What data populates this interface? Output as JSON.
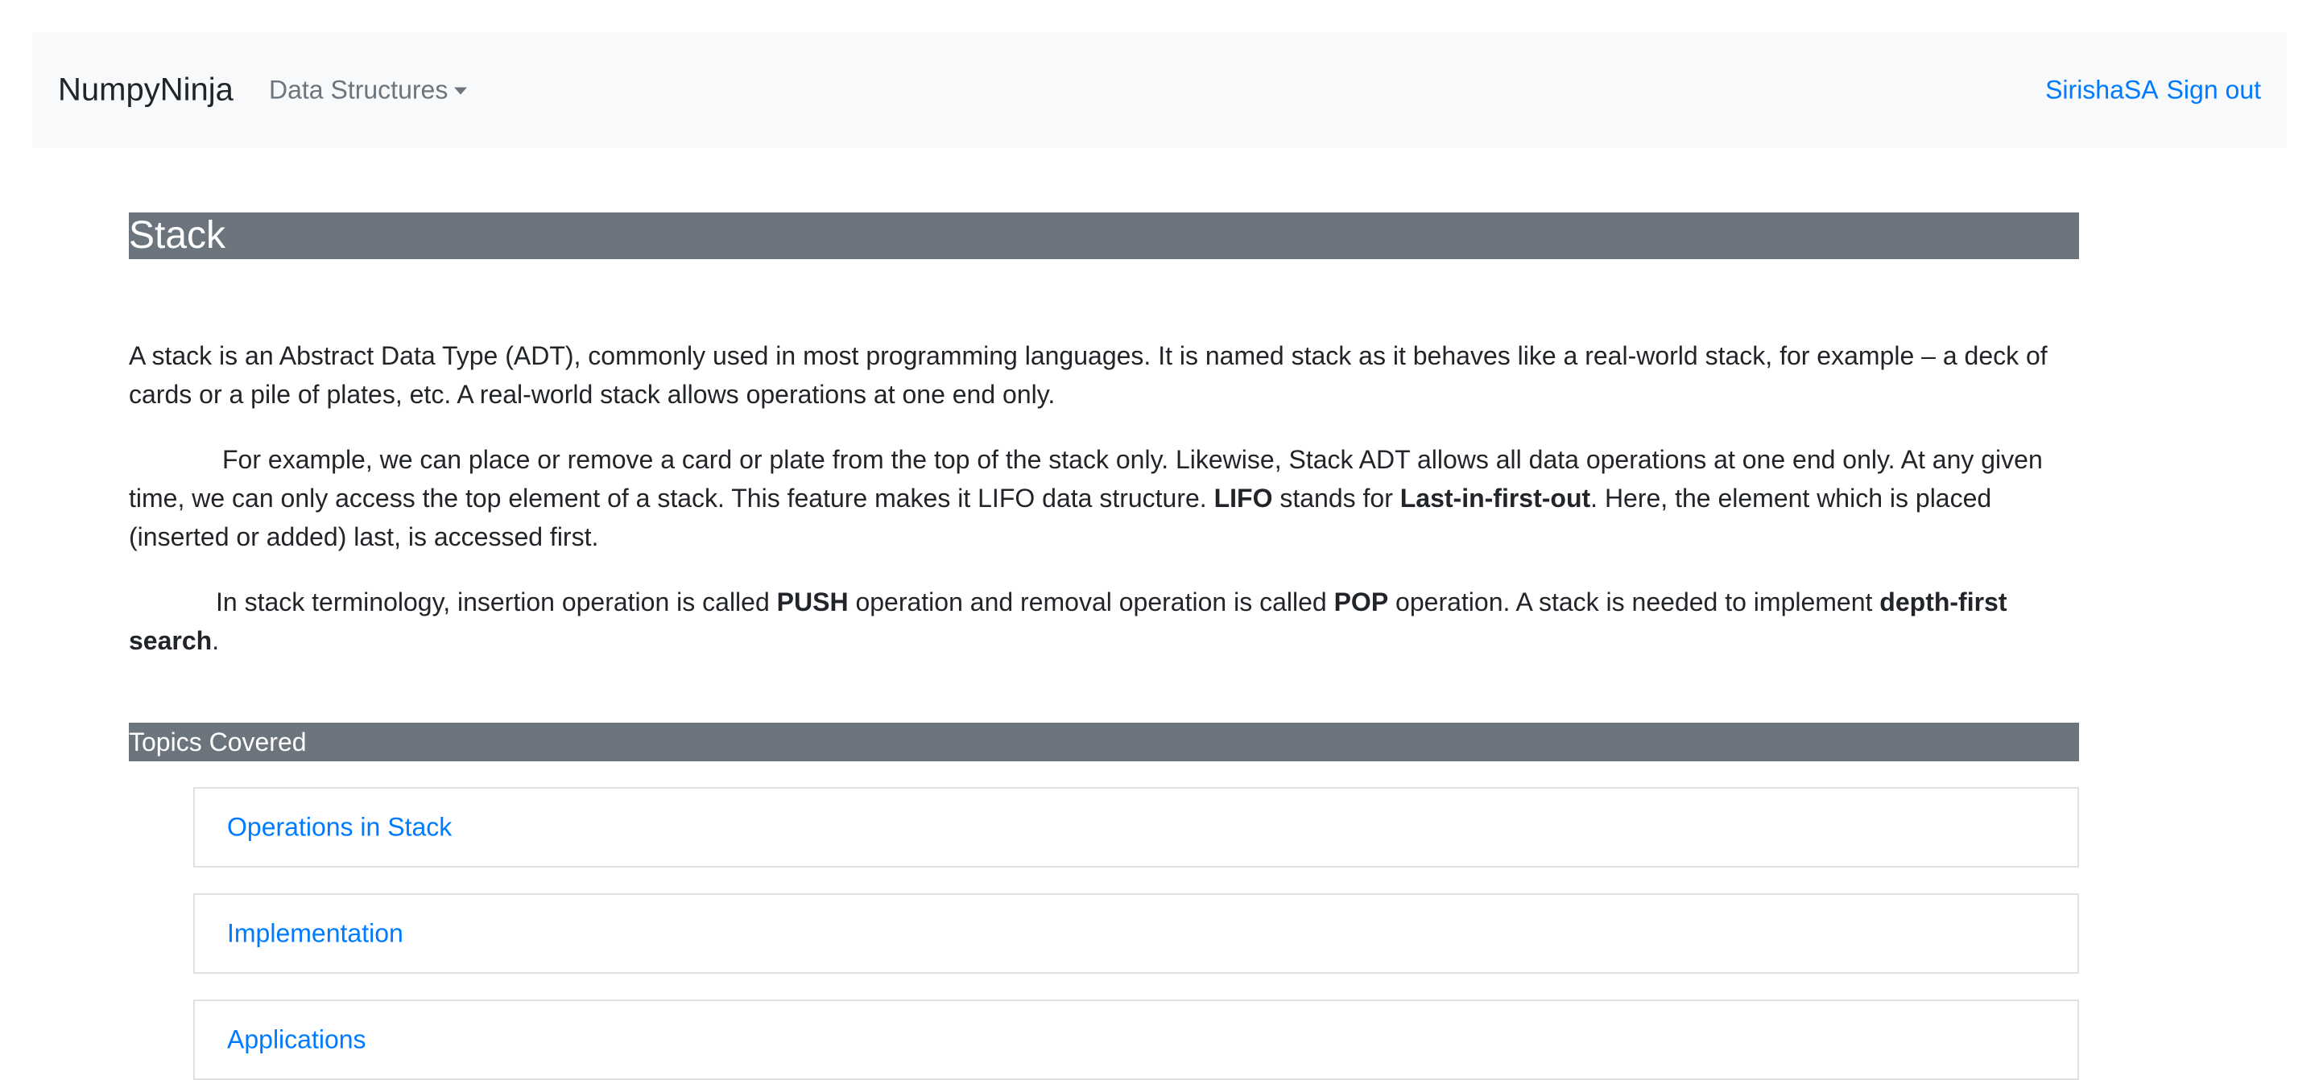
{
  "navbar": {
    "brand": "NumpyNinja",
    "dropdown_label": "Data Structures",
    "user": "SirishaSA",
    "sign_out": "Sign out"
  },
  "page": {
    "title": "Stack",
    "p1": "A stack is an Abstract Data Type (ADT), commonly used in most programming languages. It is named stack as it behaves like a real-world stack, for example – a deck of cards or a pile of plates, etc. A real-world stack allows operations at one end only.",
    "p2": {
      "a": "For example, we can place or remove a card or plate from the top of the stack only. Likewise, Stack ADT allows all data operations at one end only. At any given time, we can only access the top element of a stack. This feature makes it LIFO data structure. ",
      "lifo": "LIFO",
      "b": " stands for ",
      "lifo_full": "Last-in-first-out",
      "c": ". Here, the element which is placed (inserted or added) last, is accessed first."
    },
    "p3": {
      "a": "In stack terminology, insertion operation is called ",
      "push": "PUSH",
      "b": " operation and removal operation is called ",
      "pop": "POP",
      "c": " operation. A stack is needed to implement ",
      "dfs": "depth-first search",
      "d": "."
    }
  },
  "topics": {
    "heading": "Topics Covered",
    "items": [
      {
        "label": "Operations in Stack"
      },
      {
        "label": "Implementation"
      },
      {
        "label": "Applications"
      }
    ]
  },
  "colors": {
    "accent": "#007bff",
    "header_bar": "#6c757d",
    "navbar_bg": "#f8f9fa"
  }
}
